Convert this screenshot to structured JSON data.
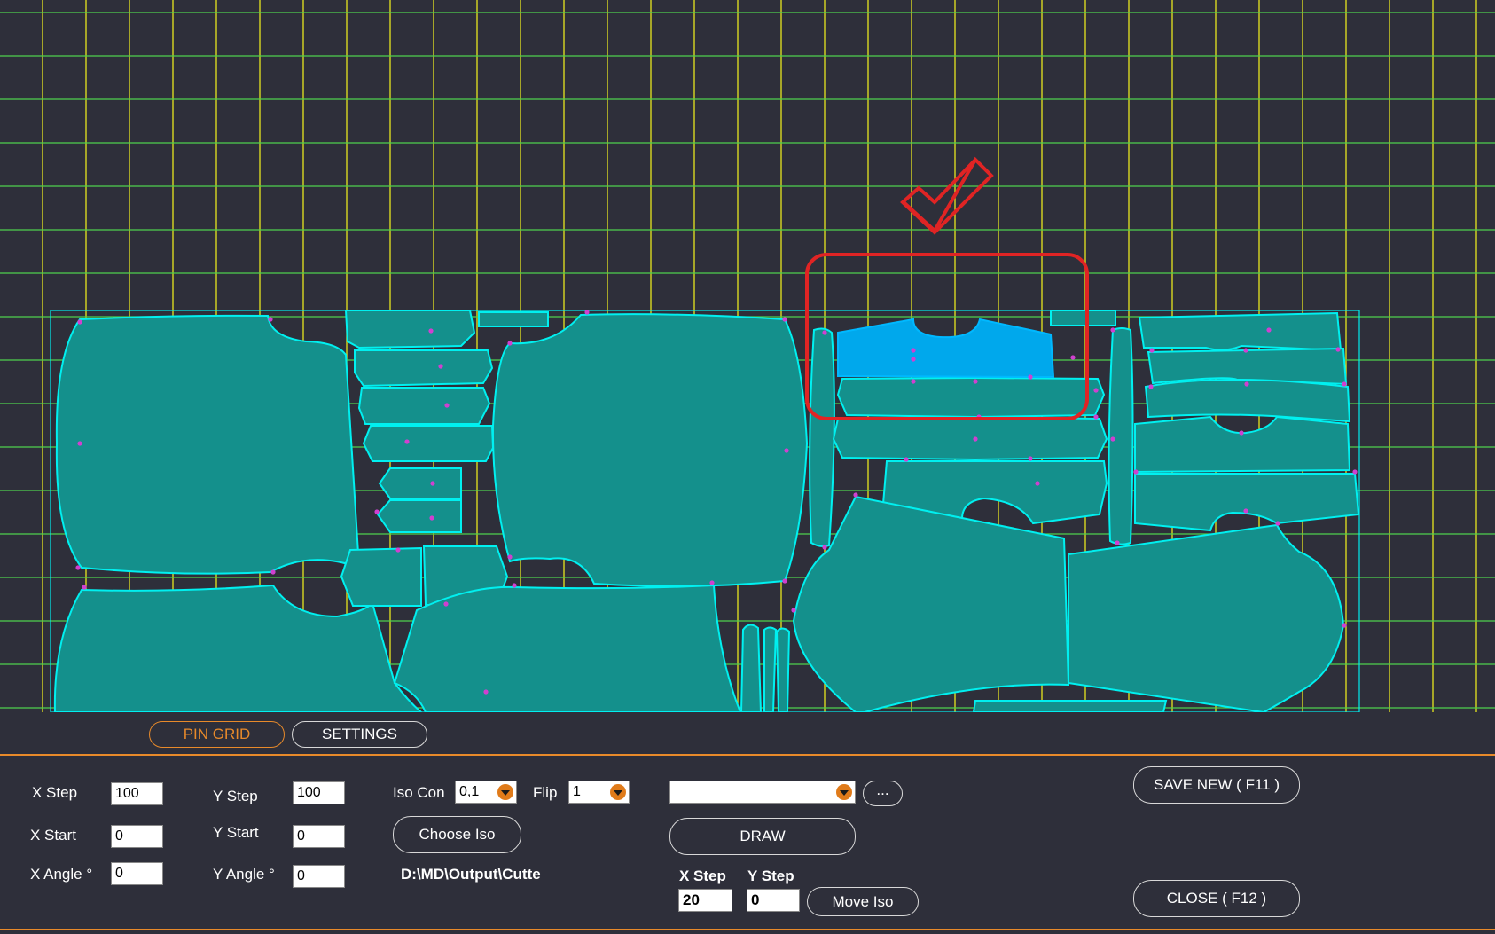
{
  "tabs": {
    "pin_grid": "PIN GRID",
    "settings": "SETTINGS"
  },
  "grid_panel": {
    "x_step_label": "X Step",
    "x_step_value": "100",
    "x_start_label": "X Start",
    "x_start_value": "0",
    "x_angle_label": "X Angle °",
    "x_angle_value": "0",
    "y_step_label": "Y Step",
    "y_step_value": "100",
    "y_start_label": "Y Start",
    "y_start_value": "0",
    "y_angle_label": "Y Angle °",
    "y_angle_value": "0"
  },
  "iso": {
    "iso_con_label": "Iso Con",
    "iso_con_value": "0,1",
    "flip_label": "Flip",
    "flip_value": "1",
    "choose_iso_label": "Choose Iso",
    "path": "D:\\MD\\Output\\Cutte",
    "file_select_value": "",
    "browse_label": "..."
  },
  "draw": {
    "draw_label": "DRAW",
    "x_step_label": "X Step",
    "x_step_value": "20",
    "y_step_label": "Y Step",
    "y_step_value": "0",
    "move_iso_label": "Move Iso"
  },
  "actions": {
    "save_new_label": "SAVE NEW ( F11 )",
    "close_label": "CLOSE ( F12 )"
  },
  "colors": {
    "background": "#2e2f3a",
    "grid_vertical": "#e6e61e",
    "grid_horizontal": "#4ed14e",
    "piece_fill": "#14908c",
    "piece_outline": "#00f0f0",
    "selected_piece": "#00a8ec",
    "annotation": "#e02424",
    "accent": "#e88a2a",
    "pin_marker": "#d040d0"
  }
}
